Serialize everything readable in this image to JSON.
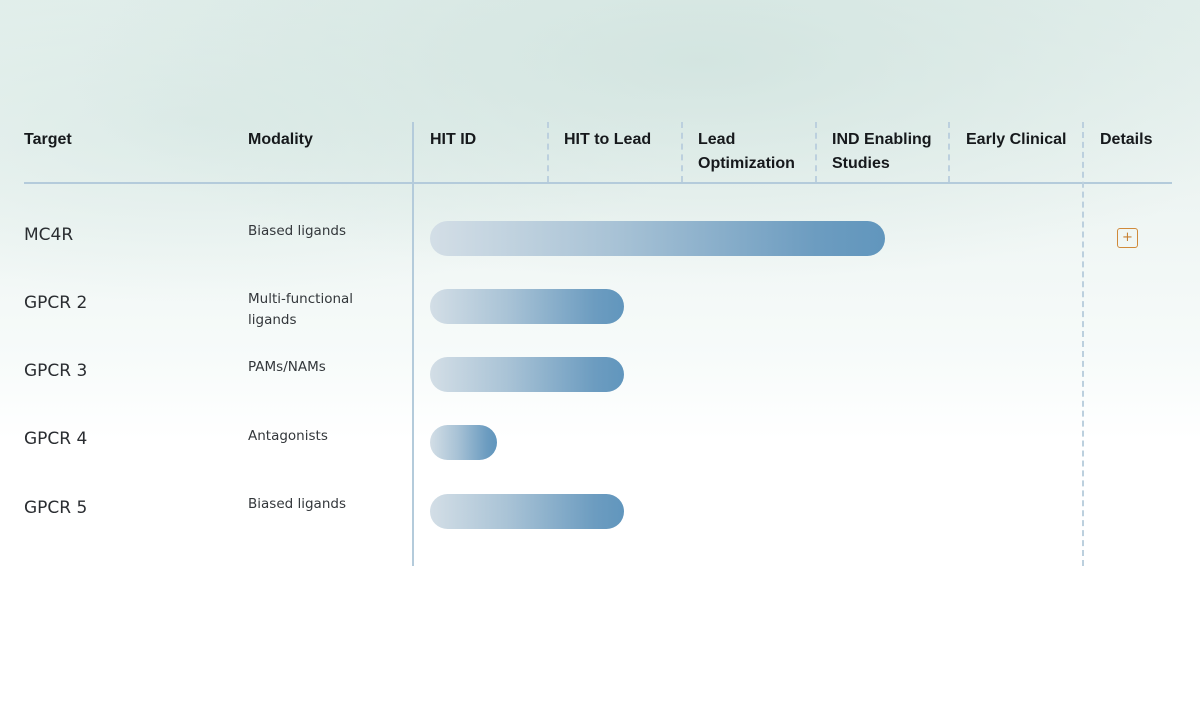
{
  "headers": {
    "target": "Target",
    "modality": "Modality",
    "phases": [
      "HIT ID",
      "HIT to Lead",
      "Lead Optimization",
      "IND Enabling Studies",
      "Early Clinical"
    ],
    "details": "Details"
  },
  "rows": [
    {
      "target": "MC4R",
      "modality": "Biased ligands",
      "progress_phases": 3.4,
      "has_details": true
    },
    {
      "target": "GPCR 2",
      "modality": "Multi-functional ligands",
      "progress_phases": 1.45
    },
    {
      "target": "GPCR 3",
      "modality": "PAMs/NAMs",
      "progress_phases": 1.45
    },
    {
      "target": "GPCR 4",
      "modality": "Antagonists",
      "progress_phases": 0.5
    },
    {
      "target": "GPCR 5",
      "modality": "Biased ligands",
      "progress_phases": 1.45
    }
  ],
  "details_button": {
    "icon": "plus-icon",
    "label": "+"
  },
  "colors": {
    "bar_start": "#d3dee6",
    "bar_end": "#6196bd",
    "grid_line": "#b4cbdb",
    "details_accent": "#d08a3a"
  }
}
